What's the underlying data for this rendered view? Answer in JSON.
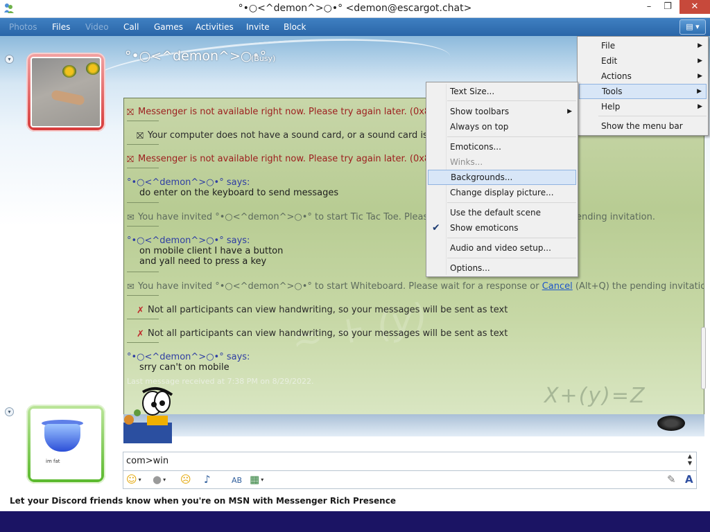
{
  "window": {
    "title": "°•○<^demon^>○•° <demon@escargot.chat>",
    "min_label": "–",
    "max_label": "❐",
    "close_label": "✕"
  },
  "toolbar": {
    "items": [
      {
        "label": "Photos",
        "enabled": false
      },
      {
        "label": "Files",
        "enabled": true
      },
      {
        "label": "Video",
        "enabled": false
      },
      {
        "label": "Call",
        "enabled": true
      },
      {
        "label": "Games",
        "enabled": true
      },
      {
        "label": "Activities",
        "enabled": true
      },
      {
        "label": "Invite",
        "enabled": true
      },
      {
        "label": "Block",
        "enabled": true
      }
    ]
  },
  "contact": {
    "name": "°•○<^demon^>○•°",
    "status": "(Busy)"
  },
  "conversation": {
    "messages": [
      {
        "type": "error",
        "text": "Messenger is not available right now. Please try again later. (0x8ac7000"
      },
      {
        "type": "system",
        "text": "Your computer does not have a sound card, or a sound card is not s"
      },
      {
        "type": "error",
        "text": "Messenger is not available right now. Please try again later. (0x8ac7000"
      },
      {
        "type": "chat",
        "sender": "°•○<^demon^>○•° says:",
        "lines": [
          "do enter on the keyboard to send messages"
        ]
      },
      {
        "type": "invite",
        "text": "You have invited °•○<^demon^>○•° to start Tic Tac Toe. Please wait fo",
        "tail": "ending invitation."
      },
      {
        "type": "chat",
        "sender": "°•○<^demon^>○•° says:",
        "lines": [
          "on mobile client I have a button",
          "and yall need to press a key"
        ]
      },
      {
        "type": "invite",
        "text": "You have invited °•○<^demon^>○•° to start Whiteboard. Please wait for a response or",
        "link": "Cancel",
        "tail": "(Alt+Q) the pending invitation."
      },
      {
        "type": "system",
        "text": "Not all participants can view handwriting, so your messages will be sent as text"
      },
      {
        "type": "system",
        "text": "Not all participants can view handwriting, so your messages will be sent as text"
      },
      {
        "type": "chat",
        "sender": "°•○<^demon^>○•° says:",
        "lines": [
          "srry can't on mobile"
        ]
      }
    ],
    "last_received": "Last message received at 7:38 PM on 8/29/2022.",
    "background_deco": "X+(y)=Z"
  },
  "input": {
    "value": "com>win"
  },
  "my_avatar": {
    "caption": "im fat"
  },
  "promo": "Let your Discord friends know when you're on MSN with Messenger Rich Presence",
  "main_menu": {
    "items": [
      {
        "label": "File",
        "submenu": true
      },
      {
        "label": "Edit",
        "submenu": true
      },
      {
        "label": "Actions",
        "submenu": true
      },
      {
        "label": "Tools",
        "submenu": true,
        "active": true
      },
      {
        "label": "Help",
        "submenu": true
      },
      {
        "label": "Show the menu bar",
        "submenu": false
      }
    ]
  },
  "tools_menu": {
    "items": [
      {
        "label": "Text Size..."
      },
      {
        "label": "Show toolbars",
        "submenu": true
      },
      {
        "label": "Always on top"
      },
      {
        "label": "Emoticons..."
      },
      {
        "label": "Winks...",
        "disabled": true
      },
      {
        "label": "Backgrounds...",
        "highlight": true
      },
      {
        "label": "Change display picture..."
      },
      {
        "label": "Use the default scene"
      },
      {
        "label": "Show emoticons",
        "checked": true
      },
      {
        "label": "Audio and video setup..."
      },
      {
        "label": "Options..."
      }
    ]
  },
  "colors": {
    "toolbar": "#2f6fb0",
    "error_text": "#9c1d1d",
    "sender_text": "#2e3da3",
    "highlight": "#d8e6f7",
    "busy_frame": "#d63a3a",
    "online_frame": "#58b82b"
  }
}
